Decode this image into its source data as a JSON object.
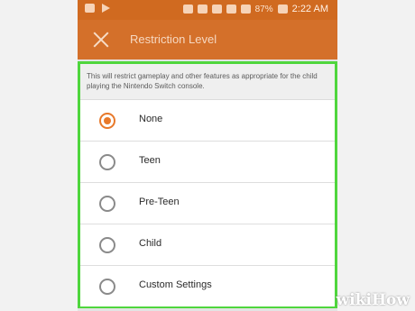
{
  "status_bar": {
    "left_icons": [
      "gallery-icon",
      "send-icon"
    ],
    "right_icons": [
      "sim-icon",
      "bluetooth-icon",
      "nfc-icon",
      "wifi-icon",
      "signal-icon"
    ],
    "battery": "87%",
    "time": "2:22 AM"
  },
  "app_bar": {
    "title": "Restriction Level",
    "close_icon": "close-icon",
    "color": "#d4702a"
  },
  "description": "This will restrict gameplay and other features as appropriate for the child playing the Nintendo Switch console.",
  "options": [
    {
      "label": "None",
      "selected": true
    },
    {
      "label": "Teen",
      "selected": false
    },
    {
      "label": "Pre-Teen",
      "selected": false
    },
    {
      "label": "Child",
      "selected": false
    },
    {
      "label": "Custom Settings",
      "selected": false
    }
  ],
  "highlight_color": "#4fd63d",
  "accent_color": "#e8792a",
  "watermark": {
    "part1": "wiki",
    "part2": "How"
  }
}
